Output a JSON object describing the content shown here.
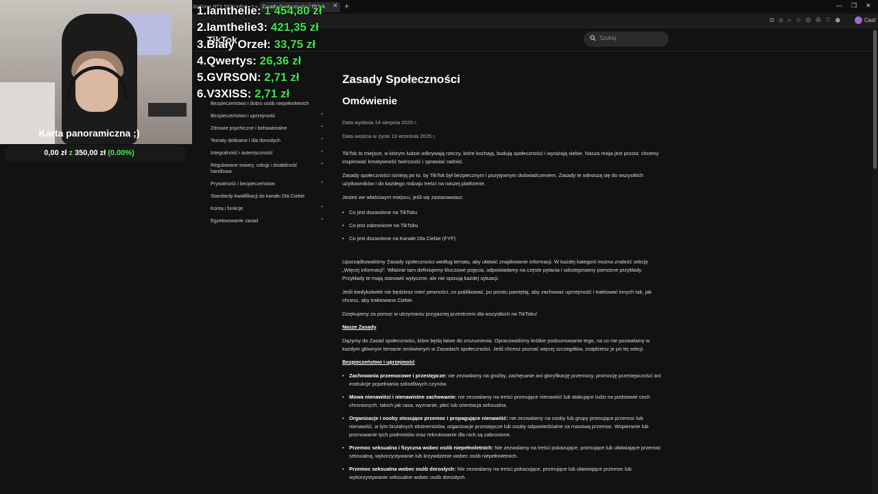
{
  "browser": {
    "tabs": [
      {
        "title": "lt GeForce RTX 5070 Infinity 3 w..."
      },
      {
        "title": "Zasady Społeczności | TikTok"
      }
    ],
    "cast_label": "Cast"
  },
  "page": {
    "logo": "TikTok",
    "search_placeholder": "Szukaj",
    "nav": [
      {
        "label": "Bezpieczeństwo i dobro osób niepełnoletnich",
        "chevron": false
      },
      {
        "label": "Bezpieczeństwo i uprzejmość",
        "chevron": true
      },
      {
        "label": "Zdrowie psychiczne i behawioralne",
        "chevron": true
      },
      {
        "label": "Tematy delikatne i dla dorosłych",
        "chevron": true
      },
      {
        "label": "Integralność i autentyczność",
        "chevron": true
      },
      {
        "label": "Regulowane towary, usługi i działalność handlowa",
        "chevron": true
      },
      {
        "label": "Prywatność i bezpieczeństwo",
        "chevron": true
      },
      {
        "label": "Standardy kwalifikacji do kanału Dla Ciebie",
        "chevron": false
      },
      {
        "label": "Konta i funkcje",
        "chevron": true
      },
      {
        "label": "Egzekwowanie zasad",
        "chevron": true
      }
    ],
    "title": "Zasady Społeczności",
    "subtitle": "Omówienie",
    "date_published": "Data wydania 14 sierpnia 2025 r.",
    "date_effective": "Data wejścia w życie 13 września 2025 r.",
    "intro_1": "TikTok to miejsce, w którym ludzie odkrywają rzeczy, które kochają, budują społeczności i wyrażają siebie. Nasza misja jest prosta: chcemy inspirować kreatywność twórczość i sprawiać radość.",
    "intro_2": "Zasady społeczności istnieją po to, by TikTok był bezpiecznym i pozytywnym doświadczeniem. Zasady te odnoszą się do wszystkich użytkowników i do każdego rodzaju treści na naszej platformie.",
    "intro_3": "Jesteś we właściwym miejscu, jeśli się zastanawiasz:",
    "questions": [
      "Co jest dozwolone na TikToku",
      "Co jest zabronione na TikToku",
      "Co jest dozwolone na Kanale Dla Ciebie (FYF)"
    ],
    "para_1": "Uporządkowaliśmy Zasady społeczności według tematu, aby ułatwić znajdowanie informacji. W każdej kategorii można znaleźć sekcję „Więcej informacji”. Właśnie tam definiujemy kluczowe pojęcia, odpowiadamy na częste pytania i udostępniamy pomocne przykłady. Przykłady te mają stanowić wytyczne, ale nie opisują każdej sytuacji.",
    "para_2": "Jeśli kiedykolwiek nie będziesz mieć pewności, co publikować, po prostu pamiętaj, aby zachować uprzejmość i traktować innych tak, jak chcesz, aby traktowano Ciebie.",
    "para_3": "Dziękujemy za pomoc w utrzymaniu przyjaznej przestrzeni dla wszystkich na TikToku!",
    "section_rules": "Nasze Zasady",
    "para_4": "Dążymy do Zasad społeczności, które będą łatwe do zrozumienia. Opracowaliśmy krótkie podsumowanie tego, na co nie pozwalamy w każdym głównym temacie omówionym w Zasadach społeczności. Jeśli chcesz poznać więcej szczegółów, znajdziesz je po tej sekcji.",
    "section_safety": "Bezpieczeństwo i uprzejmość",
    "rules": [
      {
        "title": "Zachowania przemocowe i przestępcze:",
        "text": " nie zezwalamy na groźby, zachęcanie ani gloryfikację przemocy, promocję przestępczości ani instrukcje popełniania szkodliwych czynów."
      },
      {
        "title": "Mowa nienawiści i nienawistne zachowanie:",
        "text": " nie zezwalamy na treści promujące nienawiść lub atakujące ludzi na podstawie cech chronionych, takich jak rasa, wyznanie, płeć lub orientacja seksualna."
      },
      {
        "title": "Organizacje i osoby stosujące przemoc i propagujące nienawiść:",
        "text": " nie zezwalamy na osoby lub grupy promujące przemoc lub nienawiść, w tym brutalnych ekstremistów, organizacje przestępcze lub osoby odpowiedzialne za masową przemoc. Wspieranie lub promowanie tych podmiotów oraz rekrutowanie dla nich są zabronione."
      },
      {
        "title": "Przemoc seksualna i fizyczna wobec osób niepełnoletnich:",
        "text": " Nie zezwalamy na treści pokazujące, promujące lub ułatwiające przemoc seksualną, wykorzystywanie lub krzywdzenie wobec osób niepełnoletnich."
      },
      {
        "title": "Przemoc seksualna wobec osób dorosłych:",
        "text": " Nie zezwalamy na treści pokazujące, promujące lub ułatwiające przemoc lub wykorzystywanie seksualne wobec osób dorosłych."
      }
    ]
  },
  "overlay": {
    "goal_title": "Karta panoramiczna ;)",
    "goal_current": "0,00 zł",
    "goal_sep": "z",
    "goal_target": "350,00 zł",
    "goal_percent": "(0.00%)",
    "leaderboard": [
      {
        "rank": "1.",
        "name": "Iamthelie:",
        "amount": "1 454,80 zł"
      },
      {
        "rank": "2.",
        "name": "Iamthelie3:",
        "amount": "421,35 zł"
      },
      {
        "rank": "3.",
        "name": "Biały Orzeł:",
        "amount": "33,75 zł"
      },
      {
        "rank": "4.",
        "name": "Qwertys:",
        "amount": "26,36 zł"
      },
      {
        "rank": "5.",
        "name": "GVRSON:",
        "amount": "2,71 zł"
      },
      {
        "rank": "6.",
        "name": "V3XISS:",
        "amount": "2,71 zł"
      }
    ]
  }
}
